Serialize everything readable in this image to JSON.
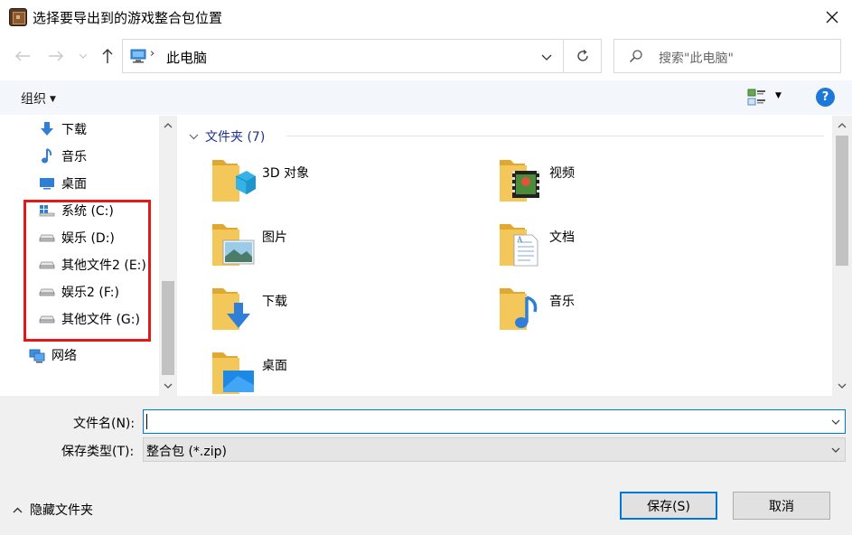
{
  "window": {
    "title": "选择要导出到的游戏整合包位置",
    "close_label": "✕"
  },
  "navigation": {
    "back": "←",
    "forward": "→",
    "recent": "⌄",
    "up": "↑"
  },
  "address": {
    "chevron": "›",
    "path": "此电脑",
    "dropdown": "⌄",
    "refresh": "↻"
  },
  "search": {
    "placeholder": "搜索\"此电脑\""
  },
  "toolbar": {
    "organize": "组织",
    "organize_caret": "▼",
    "view_caret": "▼",
    "help": "?"
  },
  "sidebar": {
    "items": [
      {
        "label": "下载",
        "icon": "download-arrow-icon"
      },
      {
        "label": "音乐",
        "icon": "music-note-icon"
      },
      {
        "label": "桌面",
        "icon": "desktop-icon"
      },
      {
        "label": "系统 (C:)",
        "icon": "windows-drive-icon"
      },
      {
        "label": "娱乐 (D:)",
        "icon": "drive-icon"
      },
      {
        "label": "其他文件2 (E:)",
        "icon": "drive-icon"
      },
      {
        "label": "娱乐2 (F:)",
        "icon": "drive-icon"
      },
      {
        "label": "其他文件 (G:)",
        "icon": "drive-icon"
      },
      {
        "label": "网络",
        "icon": "network-icon"
      }
    ],
    "highlight_color": "#e21919"
  },
  "content": {
    "group_header": "文件夹 (7)",
    "group_chevron": "⌄",
    "folders": [
      {
        "label": "3D 对象",
        "icon": "3d-objects-folder-icon"
      },
      {
        "label": "视频",
        "icon": "videos-folder-icon"
      },
      {
        "label": "图片",
        "icon": "pictures-folder-icon"
      },
      {
        "label": "文档",
        "icon": "documents-folder-icon"
      },
      {
        "label": "下载",
        "icon": "downloads-folder-icon"
      },
      {
        "label": "音乐",
        "icon": "music-folder-icon"
      },
      {
        "label": "桌面",
        "icon": "desktop-folder-icon"
      }
    ]
  },
  "scroll": {
    "up": "︿",
    "down": "﹀"
  },
  "form": {
    "filename_label": "文件名(N):",
    "filename_value": "",
    "filetype_label": "保存类型(T):",
    "filetype_value": "整合包 (*.zip)",
    "dropdown": "⌄"
  },
  "footer": {
    "hide_folders": "隐藏文件夹",
    "hide_chevron": "︿",
    "save": "保存(S)",
    "cancel": "取消"
  },
  "colors": {
    "accent": "#0078d7",
    "folder": "#f4c75a",
    "help": "#1e78d7",
    "highlight_box": "#e21919"
  }
}
